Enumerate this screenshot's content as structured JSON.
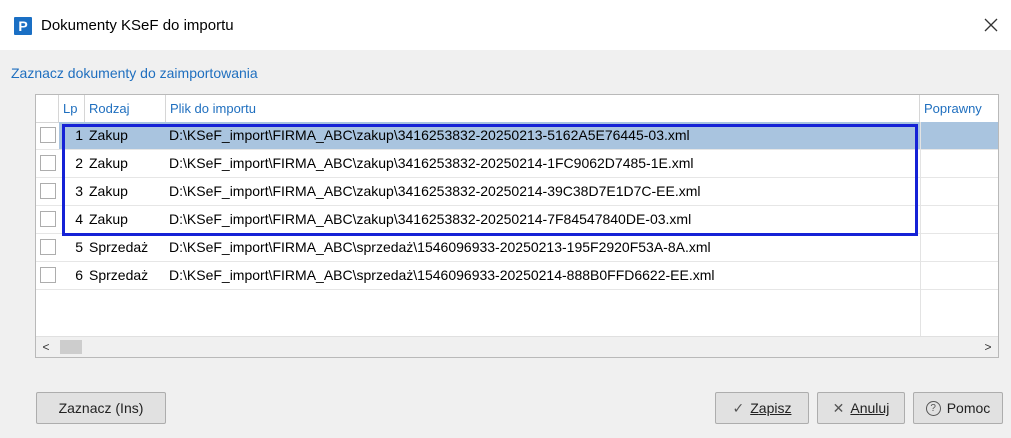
{
  "window": {
    "app_icon_letter": "P",
    "title": "Dokumenty KSeF do importu",
    "close_glyph": "✕"
  },
  "subtitle": "Zaznacz dokumenty do zaimportowania",
  "table": {
    "headers": {
      "lp": "Lp",
      "rodzaj": "Rodzaj",
      "plik": "Plik do importu",
      "poprawny": "Poprawny"
    },
    "rows": [
      {
        "lp": "1",
        "rodzaj": "Zakup",
        "plik": "D:\\KSeF_import\\FIRMA_ABC\\zakup\\3416253832-20250213-5162A5E76445-03.xml",
        "checked": false,
        "selected": true
      },
      {
        "lp": "2",
        "rodzaj": "Zakup",
        "plik": "D:\\KSeF_import\\FIRMA_ABC\\zakup\\3416253832-20250214-1FC9062D7485-1E.xml",
        "checked": false,
        "selected": false
      },
      {
        "lp": "3",
        "rodzaj": "Zakup",
        "plik": "D:\\KSeF_import\\FIRMA_ABC\\zakup\\3416253832-20250214-39C38D7E1D7C-EE.xml",
        "checked": false,
        "selected": false
      },
      {
        "lp": "4",
        "rodzaj": "Zakup",
        "plik": "D:\\KSeF_import\\FIRMA_ABC\\zakup\\3416253832-20250214-7F84547840DE-03.xml",
        "checked": false,
        "selected": false
      },
      {
        "lp": "5",
        "rodzaj": "Sprzedaż",
        "plik": "D:\\KSeF_import\\FIRMA_ABC\\sprzedaż\\1546096933-20250213-195F2920F53A-8A.xml",
        "checked": false,
        "selected": false
      },
      {
        "lp": "6",
        "rodzaj": "Sprzedaż",
        "plik": "D:\\KSeF_import\\FIRMA_ABC\\sprzedaż\\1546096933-20250214-888B0FFD6622-EE.xml",
        "checked": false,
        "selected": false
      }
    ],
    "scroll_left_glyph": "<",
    "scroll_right_glyph": ">"
  },
  "buttons": {
    "zaznacz": "Zaznacz (Ins)",
    "zapisz_glyph": "✓",
    "zapisz_key": "Z",
    "zapisz_rest": "apisz",
    "anuluj_glyph": "✕",
    "anuluj_key": "A",
    "anuluj_rest": "nuluj",
    "pomoc_glyph": "?",
    "pomoc": "Pomoc"
  },
  "colors": {
    "accent": "#1f6fbf",
    "selection": "#a9c4df",
    "highlight_box": "#1522d6"
  }
}
